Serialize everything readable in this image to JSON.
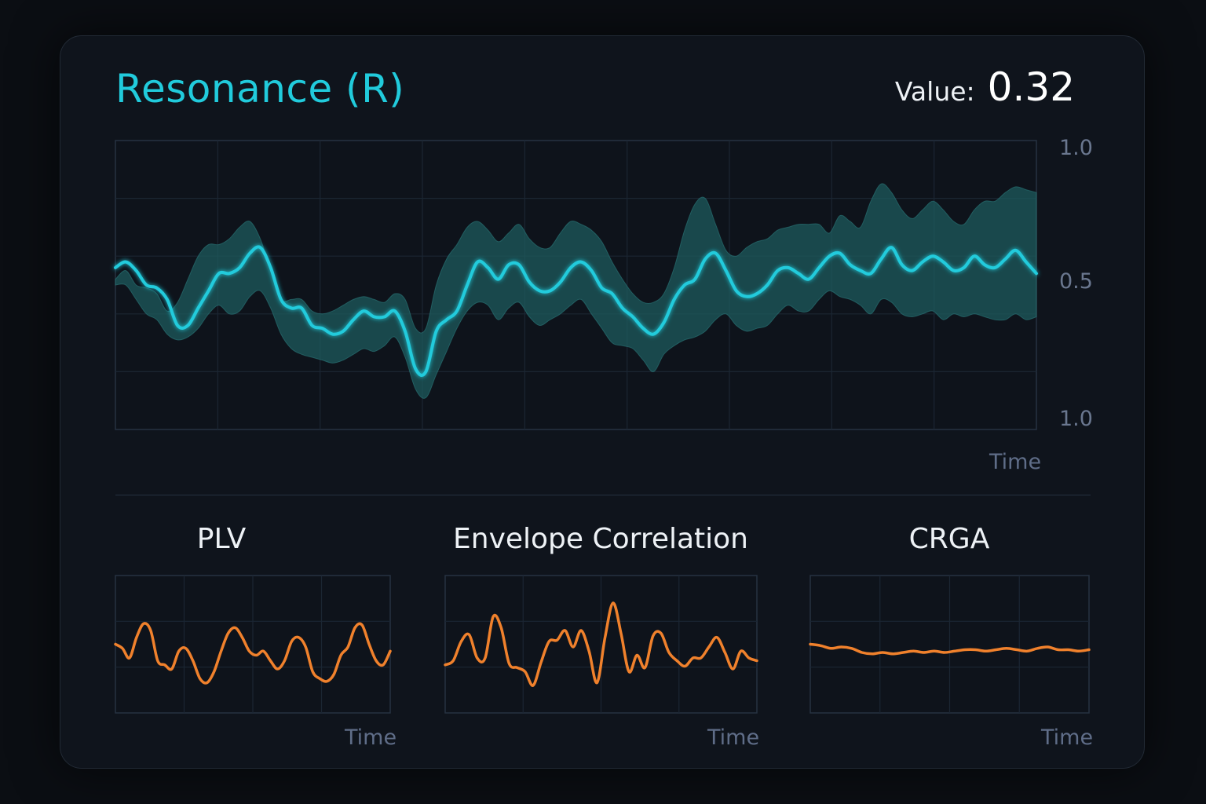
{
  "title": "Resonance (R)",
  "value_label": "Value:",
  "value": "0.32",
  "colors": {
    "accent": "#21cbdc",
    "band": "#1d5b5d",
    "orange": "#f0812c",
    "grid": "#1b2633",
    "axis_text": "#6a778f"
  },
  "chart_data": [
    {
      "type": "line",
      "title": "Resonance (R)",
      "xlabel": "Time",
      "ylabel": "",
      "ytick_labels": [
        "1.0",
        "0.5",
        "1.0"
      ],
      "ylim": [
        0,
        1
      ],
      "grid": true,
      "series": [
        {
          "values": [
            0.56,
            0.58,
            0.55,
            0.5,
            0.49,
            0.45,
            0.36,
            0.36,
            0.42,
            0.48,
            0.54,
            0.54,
            0.56,
            0.61,
            0.63,
            0.56,
            0.45,
            0.42,
            0.42,
            0.36,
            0.35,
            0.33,
            0.34,
            0.38,
            0.41,
            0.39,
            0.39,
            0.41,
            0.34,
            0.21,
            0.2,
            0.34,
            0.38,
            0.41,
            0.5,
            0.58,
            0.56,
            0.52,
            0.57,
            0.57,
            0.51,
            0.48,
            0.48,
            0.51,
            0.56,
            0.58,
            0.55,
            0.49,
            0.47,
            0.42,
            0.39,
            0.35,
            0.33,
            0.37,
            0.45,
            0.5,
            0.52,
            0.59,
            0.61,
            0.55,
            0.48,
            0.46,
            0.47,
            0.5,
            0.55,
            0.56,
            0.54,
            0.52,
            0.56,
            0.6,
            0.61,
            0.57,
            0.55,
            0.54,
            0.59,
            0.63,
            0.57,
            0.55,
            0.58,
            0.6,
            0.58,
            0.55,
            0.56,
            0.6,
            0.57,
            0.56,
            0.59,
            0.62,
            0.58,
            0.54
          ]
        },
        {
          "values": [
            0.52,
            0.55,
            0.5,
            0.49,
            0.47,
            0.41,
            0.44,
            0.52,
            0.6,
            0.64,
            0.64,
            0.66,
            0.7,
            0.72,
            0.66,
            0.55,
            0.45,
            0.45,
            0.45,
            0.41,
            0.4,
            0.41,
            0.43,
            0.45,
            0.46,
            0.45,
            0.44,
            0.47,
            0.45,
            0.35,
            0.35,
            0.5,
            0.59,
            0.64,
            0.7,
            0.72,
            0.69,
            0.65,
            0.68,
            0.71,
            0.66,
            0.63,
            0.63,
            0.68,
            0.72,
            0.71,
            0.69,
            0.65,
            0.58,
            0.52,
            0.47,
            0.44,
            0.44,
            0.47,
            0.56,
            0.69,
            0.78,
            0.8,
            0.71,
            0.62,
            0.6,
            0.63,
            0.65,
            0.66,
            0.69,
            0.7,
            0.71,
            0.71,
            0.71,
            0.68,
            0.74,
            0.72,
            0.7,
            0.79,
            0.85,
            0.82,
            0.76,
            0.73,
            0.76,
            0.79,
            0.76,
            0.72,
            0.71,
            0.76,
            0.79,
            0.79,
            0.82,
            0.84,
            0.83,
            0.82
          ]
        },
        {
          "values": [
            0.5,
            0.5,
            0.45,
            0.4,
            0.38,
            0.33,
            0.31,
            0.32,
            0.35,
            0.4,
            0.43,
            0.4,
            0.41,
            0.46,
            0.48,
            0.42,
            0.33,
            0.28,
            0.26,
            0.25,
            0.24,
            0.23,
            0.24,
            0.26,
            0.28,
            0.27,
            0.29,
            0.32,
            0.25,
            0.14,
            0.11,
            0.19,
            0.27,
            0.35,
            0.41,
            0.44,
            0.43,
            0.38,
            0.42,
            0.44,
            0.39,
            0.36,
            0.38,
            0.4,
            0.43,
            0.45,
            0.4,
            0.35,
            0.3,
            0.29,
            0.28,
            0.24,
            0.2,
            0.26,
            0.29,
            0.31,
            0.32,
            0.34,
            0.38,
            0.4,
            0.36,
            0.34,
            0.35,
            0.36,
            0.4,
            0.43,
            0.41,
            0.41,
            0.45,
            0.48,
            0.46,
            0.45,
            0.43,
            0.4,
            0.45,
            0.44,
            0.4,
            0.39,
            0.4,
            0.41,
            0.38,
            0.4,
            0.39,
            0.4,
            0.39,
            0.38,
            0.38,
            0.4,
            0.38,
            0.39
          ]
        }
      ]
    },
    {
      "type": "line",
      "title": "PLV",
      "xlabel": "Time",
      "ylim": [
        0,
        1
      ],
      "grid": true,
      "series": [
        {
          "values": [
            0.5,
            0.47,
            0.4,
            0.55,
            0.65,
            0.6,
            0.38,
            0.35,
            0.32,
            0.45,
            0.47,
            0.38,
            0.25,
            0.22,
            0.3,
            0.45,
            0.58,
            0.62,
            0.55,
            0.45,
            0.42,
            0.45,
            0.38,
            0.32,
            0.38,
            0.52,
            0.55,
            0.48,
            0.3,
            0.25,
            0.23,
            0.28,
            0.42,
            0.48,
            0.62,
            0.64,
            0.5,
            0.38,
            0.35,
            0.45
          ]
        }
      ]
    },
    {
      "type": "line",
      "title": "Envelope Correlation",
      "xlabel": "Time",
      "ylim": [
        0,
        1
      ],
      "grid": true,
      "series": [
        {
          "values": [
            0.35,
            0.38,
            0.52,
            0.57,
            0.4,
            0.4,
            0.7,
            0.62,
            0.36,
            0.33,
            0.3,
            0.2,
            0.37,
            0.52,
            0.53,
            0.6,
            0.48,
            0.6,
            0.45,
            0.22,
            0.55,
            0.8,
            0.58,
            0.3,
            0.42,
            0.33,
            0.56,
            0.58,
            0.44,
            0.38,
            0.34,
            0.4,
            0.4,
            0.48,
            0.55,
            0.44,
            0.32,
            0.45,
            0.4,
            0.38
          ]
        }
      ]
    },
    {
      "type": "line",
      "title": "CRGA",
      "xlabel": "Time",
      "ylim": [
        0,
        1
      ],
      "grid": true,
      "series": [
        {
          "values": [
            0.5,
            0.49,
            0.47,
            0.48,
            0.47,
            0.44,
            0.43,
            0.44,
            0.43,
            0.44,
            0.45,
            0.44,
            0.45,
            0.44,
            0.45,
            0.46,
            0.46,
            0.45,
            0.46,
            0.47,
            0.46,
            0.45,
            0.47,
            0.48,
            0.46,
            0.46,
            0.45,
            0.46
          ]
        }
      ]
    }
  ]
}
